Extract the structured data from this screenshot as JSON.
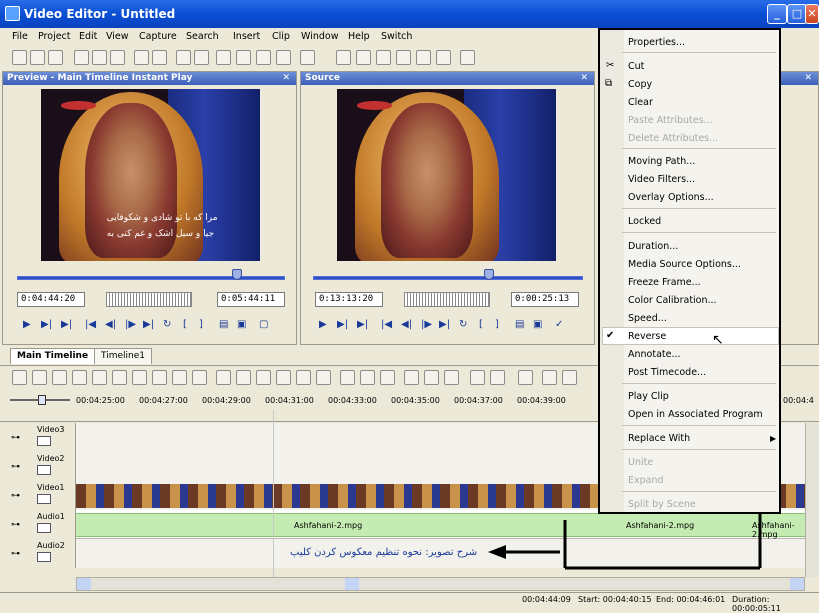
{
  "window": {
    "title": "Video Editor - Untitled"
  },
  "menu": [
    "File",
    "Project",
    "Edit",
    "View",
    "Capture",
    "Search",
    "Insert",
    "Clip",
    "Window",
    "Help",
    "Switch"
  ],
  "preview_panel": {
    "title": "Preview - Main Timeline Instant Play",
    "subtitle_line1": "مرا که با تو شادی و شکوفایی",
    "subtitle_line2": "جیا و سیل اشک و غم کنی به",
    "timecode_current": "0:04:44:20",
    "timecode_duration": "0:05:44:11"
  },
  "source_panel": {
    "title": "Source",
    "timecode_current": "0:13:13:20",
    "timecode_duration": "0:00:25:13"
  },
  "timeline": {
    "tabs": [
      "Main Timeline",
      "Timeline1"
    ],
    "ruler": [
      "00:04:25:00",
      "00:04:27:00",
      "00:04:29:00",
      "00:04:31:00",
      "00:04:33:00",
      "00:04:35:00",
      "00:04:37:00",
      "00:04:39:00"
    ],
    "ruler_edge": "00:04:4",
    "tracks": [
      "Video3",
      "Video2",
      "Video1",
      "Audio1",
      "Audio2"
    ],
    "audio_clip_1": "Ashfahani-2.mpg",
    "audio_clip_2": "Ashfahani-2.mpg",
    "audio_clip_3": "Ashfahani-2.mpg",
    "annotation": "شرح تصویر: نحوه تنظیم معکوس کردن کلیپ"
  },
  "context_menu": {
    "items": [
      {
        "label": "Properties...",
        "enabled": true
      },
      {
        "label": "Cut",
        "enabled": true
      },
      {
        "label": "Copy",
        "enabled": true
      },
      {
        "label": "Clear",
        "enabled": true
      },
      {
        "label": "Paste Attributes...",
        "enabled": false
      },
      {
        "label": "Delete Attributes...",
        "enabled": false
      },
      {
        "label": "Moving Path...",
        "enabled": true
      },
      {
        "label": "Video Filters...",
        "enabled": true
      },
      {
        "label": "Overlay Options...",
        "enabled": true
      },
      {
        "label": "Locked",
        "enabled": true
      },
      {
        "label": "Duration...",
        "enabled": true
      },
      {
        "label": "Media Source Options...",
        "enabled": true
      },
      {
        "label": "Freeze Frame...",
        "enabled": true
      },
      {
        "label": "Color Calibration...",
        "enabled": true
      },
      {
        "label": "Speed...",
        "enabled": true
      },
      {
        "label": "Reverse",
        "enabled": true,
        "checked": true
      },
      {
        "label": "Annotate...",
        "enabled": true
      },
      {
        "label": "Post Timecode...",
        "enabled": true
      },
      {
        "label": "Play Clip",
        "enabled": true
      },
      {
        "label": "Open in Associated Program",
        "enabled": true
      },
      {
        "label": "Replace With",
        "enabled": true,
        "submenu": true
      },
      {
        "label": "Unite",
        "enabled": false
      },
      {
        "label": "Expand",
        "enabled": false
      },
      {
        "label": "Split by Scene",
        "enabled": false
      }
    ]
  },
  "status": {
    "position": "00:04:44:09",
    "start": "Start: 00:04:40:15",
    "end": "End: 00:04:46:01",
    "duration": "Duration: 00:00:05:11"
  }
}
